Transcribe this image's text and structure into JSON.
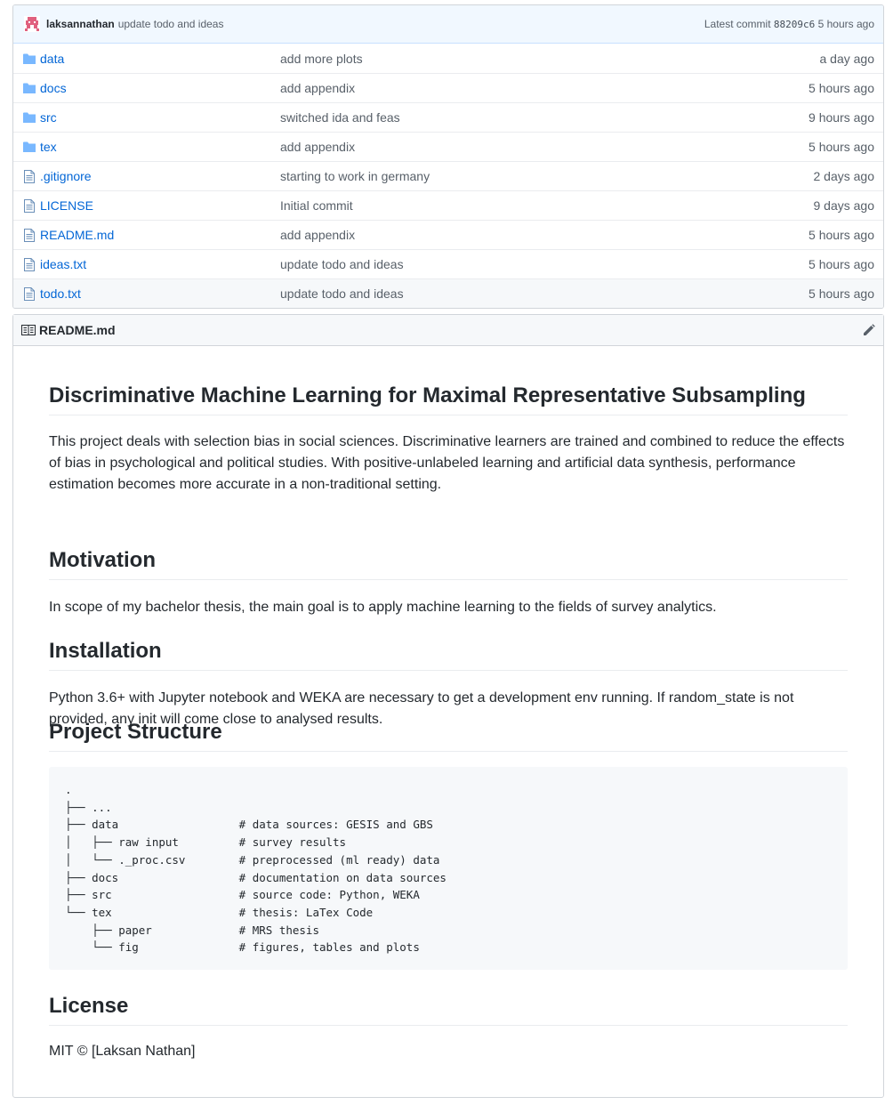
{
  "commit": {
    "author": "laksannathan",
    "message": "update todo and ideas",
    "latest_label": "Latest commit",
    "sha": "88209c6",
    "age": "5 hours ago"
  },
  "files": [
    {
      "name": "data",
      "type": "folder",
      "message": "add more plots",
      "age": "a day ago"
    },
    {
      "name": "docs",
      "type": "folder",
      "message": "add appendix",
      "age": "5 hours ago"
    },
    {
      "name": "src",
      "type": "folder",
      "message": "switched ida and feas",
      "age": "9 hours ago"
    },
    {
      "name": "tex",
      "type": "folder",
      "message": "add appendix",
      "age": "5 hours ago"
    },
    {
      "name": ".gitignore",
      "type": "file",
      "message": "starting to work in germany",
      "age": "2 days ago"
    },
    {
      "name": "LICENSE",
      "type": "file",
      "message": "Initial commit",
      "age": "9 days ago"
    },
    {
      "name": "README.md",
      "type": "file",
      "message": "add appendix",
      "age": "5 hours ago"
    },
    {
      "name": "ideas.txt",
      "type": "file",
      "message": "update todo and ideas",
      "age": "5 hours ago"
    },
    {
      "name": "todo.txt",
      "type": "file",
      "message": "update todo and ideas",
      "age": "5 hours ago"
    }
  ],
  "readme": {
    "filename": "README.md",
    "title": "Discriminative Machine Learning for Maximal Representative Subsampling",
    "intro": "This project deals with selection bias in social sciences. Discriminative learners are trained and combined to reduce the effects of bias in psychological and political studies. With positive-unlabeled learning and artificial data synthesis, performance estimation becomes more accurate in a non-traditional setting.",
    "motivation_heading": "Motivation",
    "motivation_text": "In scope of my bachelor thesis, the main goal is to apply machine learning to the fields of survey analytics.",
    "installation_heading": "Installation",
    "installation_text": "Python 3.6+ with Jupyter notebook and WEKA are necessary to get a development env running. If random_state is not provided, any init will come close to analysed results.",
    "structure_heading": "Project Structure",
    "structure_code": ".\n├── ...\n├── data                  # data sources: GESIS and GBS\n│   ├── raw input         # survey results\n│   └── ._proc.csv        # preprocessed (ml ready) data\n├── docs                  # documentation on data sources\n├── src                   # source code: Python, WEKA\n└── tex                   # thesis: LaTex Code\n    ├── paper             # MRS thesis\n    └── fig               # figures, tables and plots",
    "license_heading": "License",
    "license_text": "MIT © [Laksan Nathan]"
  },
  "colors": {
    "link": "#0366d6",
    "icon": "#79b8ff",
    "commit_bar": "#f1f8ff",
    "avatar": "#e0607e"
  },
  "icons": {
    "folder": "folder-icon",
    "file": "file-icon",
    "readme": "book-icon",
    "edit": "pencil-icon"
  }
}
